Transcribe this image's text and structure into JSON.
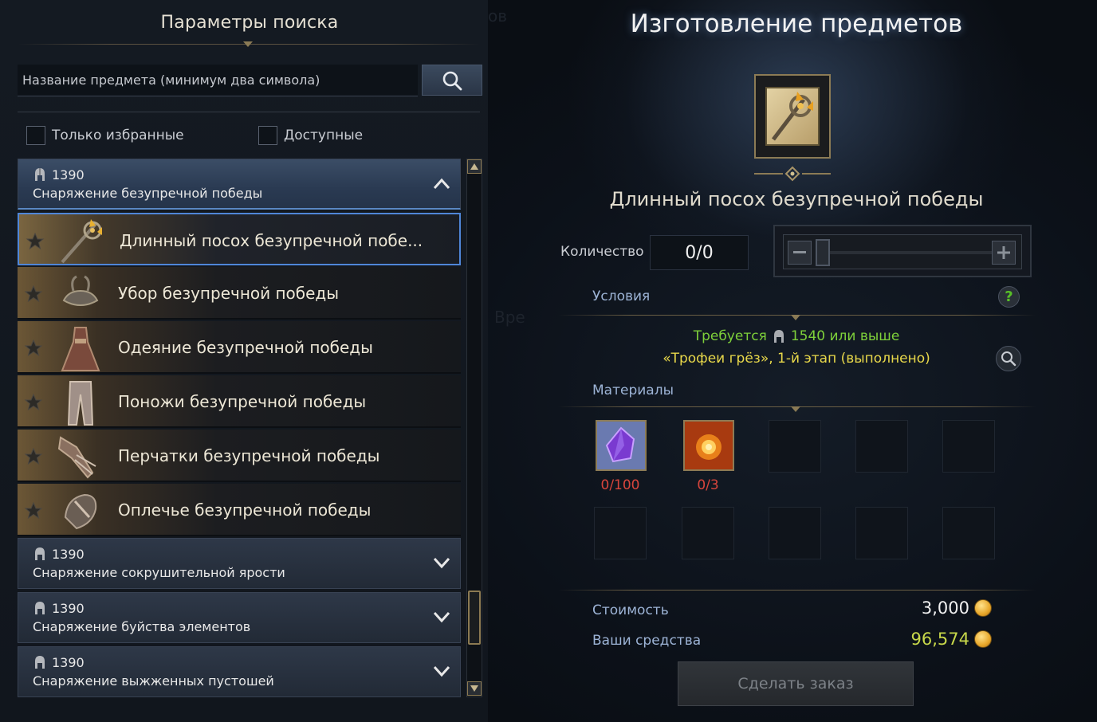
{
  "search_panel": {
    "title": "Параметры поиска",
    "search_placeholder": "Название предмета (минимум два символа)",
    "filter_favorites": "Только избранные",
    "filter_available": "Доступные"
  },
  "groups": [
    {
      "level": "1390",
      "name": "Снаряжение безупречной победы",
      "expanded": true,
      "items": [
        {
          "name": "Длинный посох безупречной побе...",
          "selected": true,
          "icon": "staff-icon"
        },
        {
          "name": "Убор безупречной победы",
          "icon": "headgear-icon"
        },
        {
          "name": "Одеяние безупречной победы",
          "icon": "robe-icon"
        },
        {
          "name": "Поножи безупречной победы",
          "icon": "leggings-icon"
        },
        {
          "name": "Перчатки безупречной победы",
          "icon": "gloves-icon"
        },
        {
          "name": "Оплечье безупречной победы",
          "icon": "shoulders-icon"
        }
      ]
    },
    {
      "level": "1390",
      "name": "Снаряжение сокрушительной ярости",
      "expanded": false
    },
    {
      "level": "1390",
      "name": "Снаряжение буйства элементов",
      "expanded": false
    },
    {
      "level": "1390",
      "name": "Снаряжение выжженных пустошей",
      "expanded": false
    }
  ],
  "crafting": {
    "title": "Изготовление предметов",
    "background_ghost_1": "Изготов",
    "background_ghost_2": "Вре",
    "item_title": "Длинный посох безупречной победы",
    "quantity_label": "Количество",
    "quantity_value": "0/0",
    "conditions_label": "Условия",
    "requirement_prefix": "Требуется",
    "requirement_level": "1540 или выше",
    "requirement_quest": "«Трофеи грёз», 1-й этап (выполнено)",
    "materials_label": "Материалы",
    "materials": [
      {
        "icon": "purple-crystal-icon",
        "count": "0/100"
      },
      {
        "icon": "fire-orb-icon",
        "count": "0/3"
      }
    ],
    "cost_label": "Стоимость",
    "cost_value": "3,000",
    "funds_label": "Ваши средства",
    "funds_value": "96,574",
    "order_button": "Сделать заказ"
  },
  "colors": {
    "accent_blue": "#4f86d8",
    "requirement_green": "#7ed03a",
    "requirement_yellow": "#e8d84a",
    "shortage_red": "#d8453c",
    "funds_green": "#c8d84a",
    "gold_frame": "#8c7b55"
  }
}
